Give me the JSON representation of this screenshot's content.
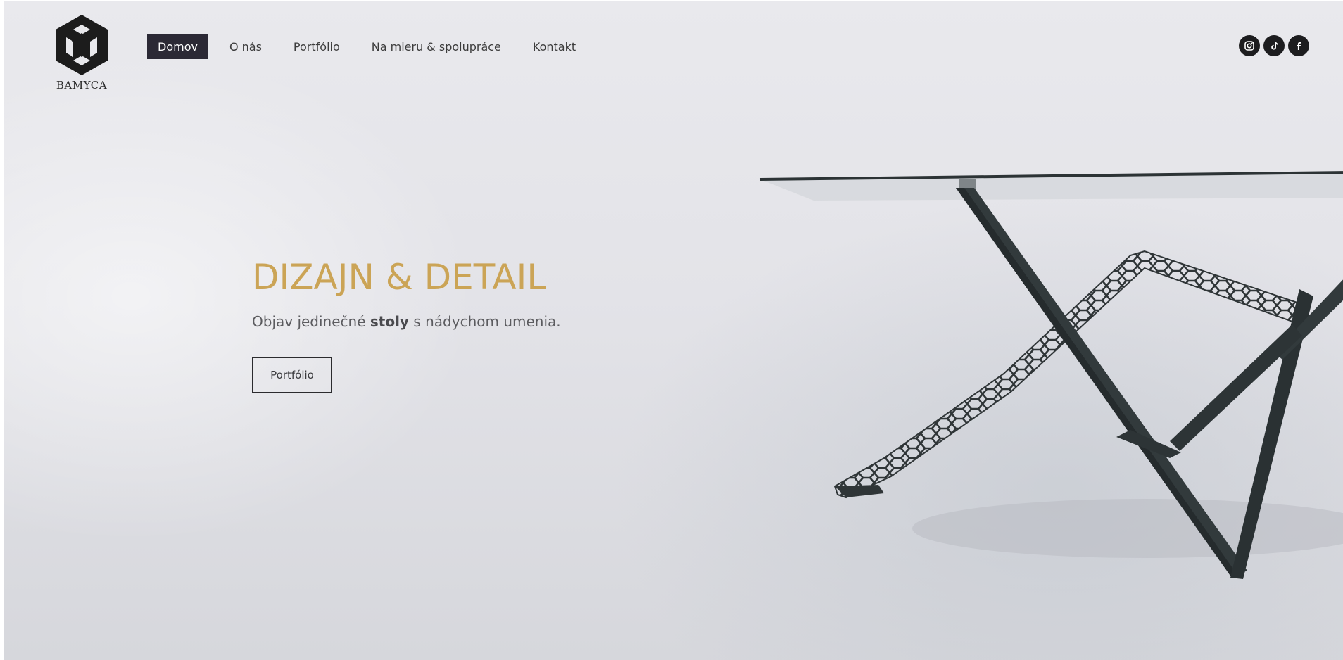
{
  "brand": {
    "name": "BAMYCA"
  },
  "nav": {
    "items": [
      {
        "label": "Domov",
        "active": true
      },
      {
        "label": "O nás",
        "active": false
      },
      {
        "label": "Portfólio",
        "active": false
      },
      {
        "label": "Na mieru & spolupráce",
        "active": false
      },
      {
        "label": "Kontakt",
        "active": false
      }
    ]
  },
  "social": [
    {
      "icon": "instagram-icon"
    },
    {
      "icon": "tiktok-icon"
    },
    {
      "icon": "facebook-icon"
    }
  ],
  "hero": {
    "headline": "DIZAJN & DETAIL",
    "subline_before": "Objav jedinečné ",
    "subline_bold": "stoly",
    "subline_after": " s nádychom umenia.",
    "button_label": "Portfólio"
  },
  "colors": {
    "accent_gold": "#cba456",
    "nav_active_bg": "#2b2935",
    "social_bg": "#1d1d1f",
    "background": "#e6e6eb"
  }
}
